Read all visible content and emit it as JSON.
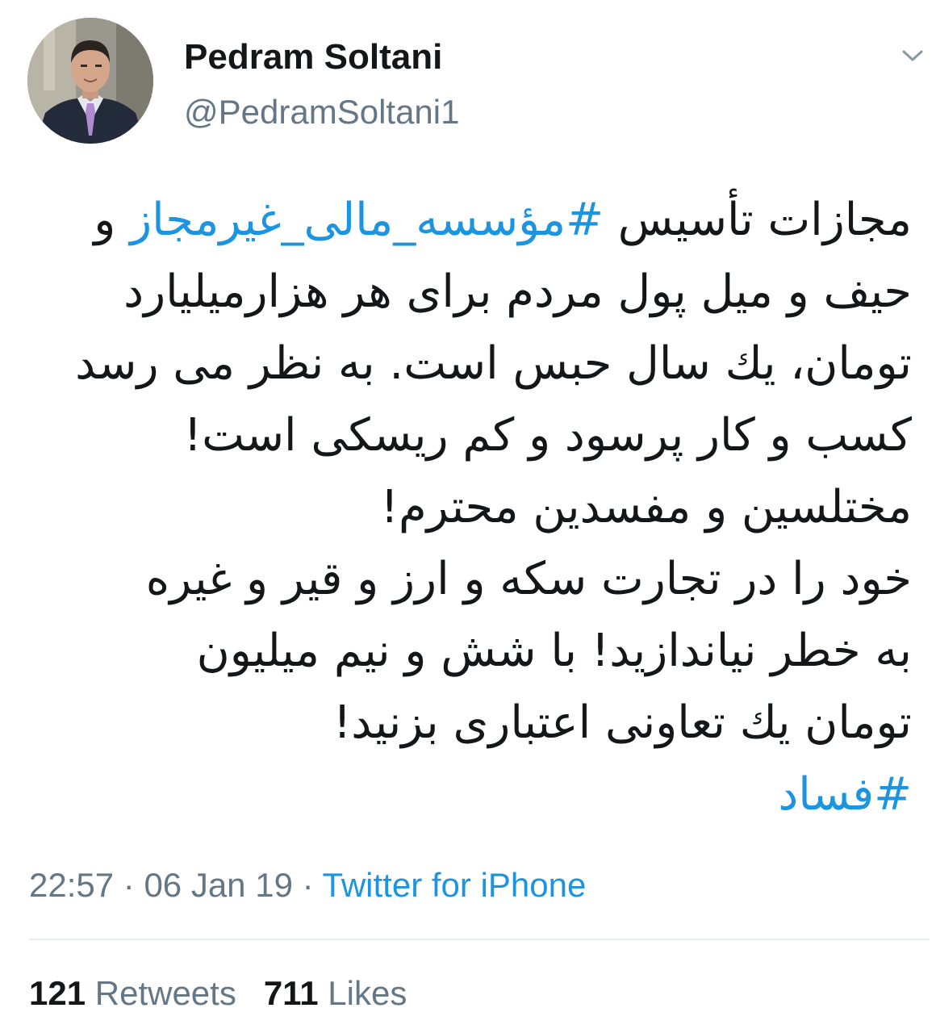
{
  "colors": {
    "text": "#14171a",
    "secondary": "#657786",
    "link": "#1b95e0",
    "divider": "#e6ecf0"
  },
  "author": {
    "name": "Pedram Soltani",
    "handle": "@PedramSoltani1",
    "avatar_icon": "profile-photo"
  },
  "menu_icon": "chevron-down-icon",
  "tweet": {
    "line1_text": "مجازات تأسیس ",
    "line1_hashtag": "#مؤسسه_مالی_غیرمجاز",
    "line1_end": " و",
    "line2": "حیف و میل پول مردم برای هر هزارمیلیارد",
    "line3": "تومان، یك سال حبس است. به نظر می رسد",
    "line4": "کسب و کار پرسود و کم ریسکی است!",
    "line5": "مختلسین و مفسدین محترم!",
    "line6": "خود را در تجارت سکه و ارز و قیر و غیره",
    "line7": "به خطر نیاندازید! با شش و نیم میلیون",
    "line8": "تومان یك تعاونی اعتباری بزنید!",
    "line9_hashtag": "#فساد"
  },
  "meta": {
    "time": "22:57",
    "sep1": " · ",
    "date": "06 Jan 19",
    "sep2": " · ",
    "source": "Twitter for iPhone"
  },
  "stats": {
    "retweets_count": "121",
    "retweets_label": "Retweets",
    "likes_count": "711",
    "likes_label": "Likes"
  }
}
